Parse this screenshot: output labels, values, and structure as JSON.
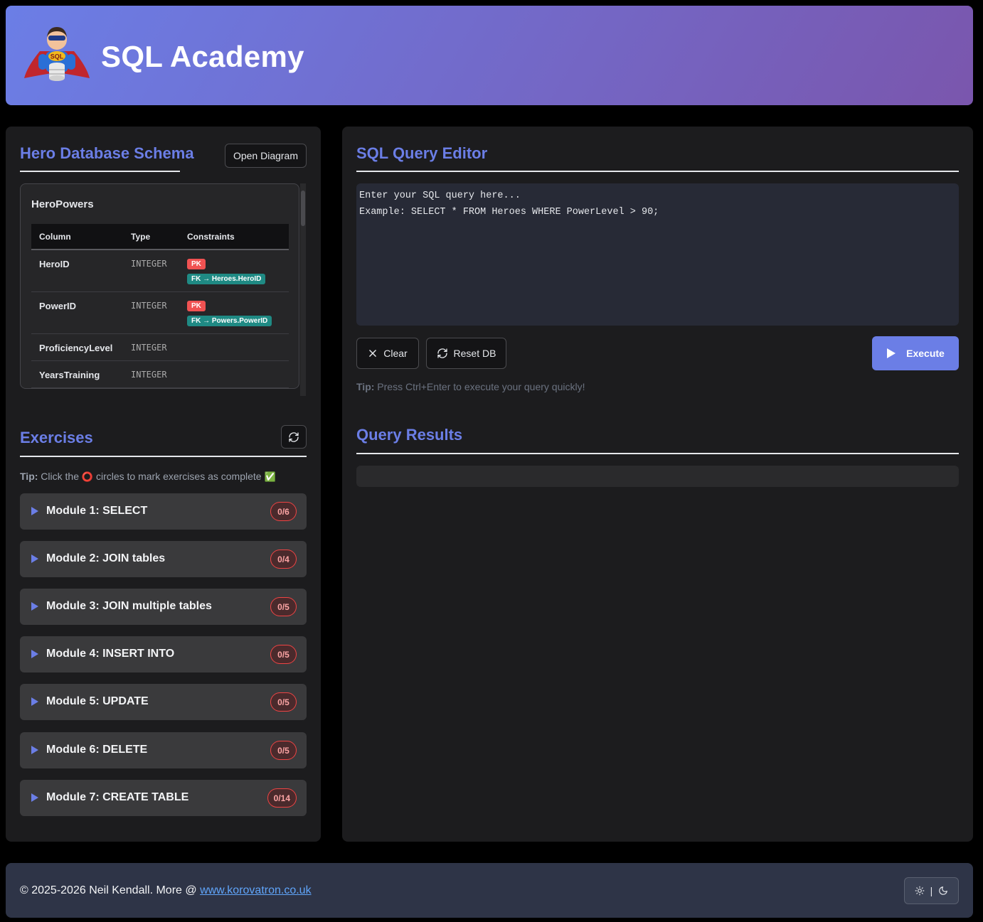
{
  "header": {
    "title": "SQL Academy",
    "logo_text": "SQL"
  },
  "schema": {
    "title": "Hero Database Schema",
    "open_diagram_label": "Open Diagram",
    "table_name": "HeroPowers",
    "columns_header": [
      "Column",
      "Type",
      "Constraints"
    ],
    "rows": [
      {
        "name": "HeroID",
        "type": "INTEGER",
        "pk": "PK",
        "fk": "FK → Heroes.HeroID"
      },
      {
        "name": "PowerID",
        "type": "INTEGER",
        "pk": "PK",
        "fk": "FK → Powers.PowerID"
      },
      {
        "name": "ProficiencyLevel",
        "type": "INTEGER",
        "pk": "",
        "fk": ""
      },
      {
        "name": "YearsTraining",
        "type": "INTEGER",
        "pk": "",
        "fk": ""
      }
    ]
  },
  "exercises": {
    "title": "Exercises",
    "tip_bold": "Tip:",
    "tip_before": "Click the",
    "tip_circle": "⭕",
    "tip_after": "circles to mark exercises as complete",
    "tip_check": "✅",
    "modules": [
      {
        "label": "Module 1: SELECT",
        "count": "0/6"
      },
      {
        "label": "Module 2: JOIN tables",
        "count": "0/4"
      },
      {
        "label": "Module 3: JOIN multiple tables",
        "count": "0/5"
      },
      {
        "label": "Module 4: INSERT INTO",
        "count": "0/5"
      },
      {
        "label": "Module 5: UPDATE",
        "count": "0/5"
      },
      {
        "label": "Module 6: DELETE",
        "count": "0/5"
      },
      {
        "label": "Module 7: CREATE TABLE",
        "count": "0/14"
      }
    ]
  },
  "editor": {
    "title": "SQL Query Editor",
    "placeholder": "Enter your SQL query here...\nExample: SELECT * FROM Heroes WHERE PowerLevel > 90;",
    "clear_label": "Clear",
    "reset_label": "Reset DB",
    "execute_label": "Execute",
    "tip_bold": "Tip:",
    "tip_text": "Press Ctrl+Enter to execute your query quickly!"
  },
  "results": {
    "title": "Query Results"
  },
  "footer": {
    "text": "© 2025-2026 Neil Kendall. More @",
    "link_text": "www.korovatron.co.uk",
    "toggle_separator": "|"
  },
  "colors": {
    "accent": "#6b7ee6",
    "header_gradient_start": "#6b7ee6",
    "header_gradient_end": "#7a56ad",
    "pk_badge": "#f05252",
    "fk_badge": "#1f8a84"
  }
}
